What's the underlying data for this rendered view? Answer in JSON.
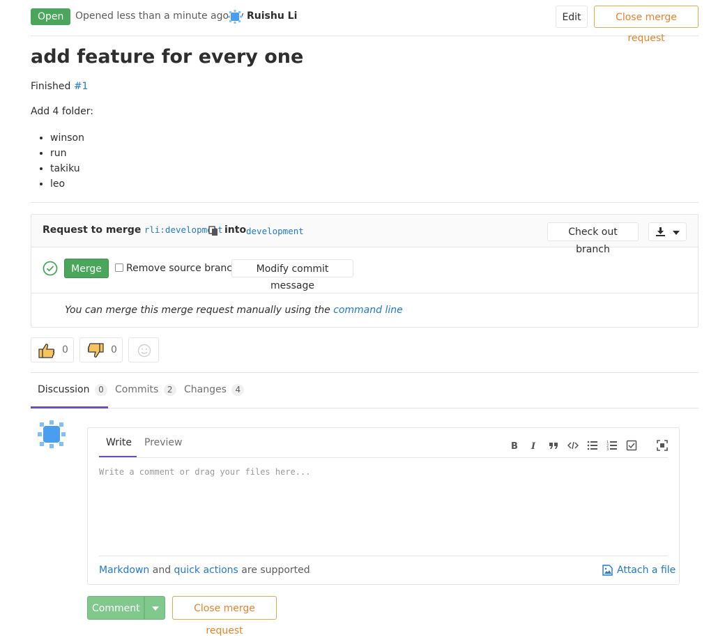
{
  "header": {
    "status_badge": "Open",
    "opened_text": "Opened less than a minute ago by",
    "author_name": "Ruishu Li",
    "edit_label": "Edit",
    "close_label": "Close merge request"
  },
  "title": "add feature for every one",
  "description": {
    "finished_prefix": "Finished",
    "finished_ref": "#1",
    "intro": "Add 4 folder:",
    "items": [
      "winson",
      "run",
      "takiku",
      "leo"
    ]
  },
  "merge_widget": {
    "request_label": "Request to merge",
    "source_branch": "rli:development",
    "into_label": "into",
    "target_branch": "development",
    "checkout_label": "Check out branch",
    "merge_label": "Merge",
    "remove_source_label": "Remove source branch",
    "modify_commit_label": "Modify commit message",
    "manual_text": "You can merge this merge request manually using the",
    "command_line_link": "command line"
  },
  "awards": {
    "thumbs_up_count": "0",
    "thumbs_down_count": "0"
  },
  "tabs": [
    {
      "label": "Discussion",
      "count": "0"
    },
    {
      "label": "Commits",
      "count": "2"
    },
    {
      "label": "Changes",
      "count": "4"
    }
  ],
  "comment_form": {
    "write_tab": "Write",
    "preview_tab": "Preview",
    "placeholder": "Write a comment or drag your files here...",
    "markdown_link": "Markdown",
    "and_text": "and",
    "quick_actions_link": "quick actions",
    "supported_text": "are supported",
    "attach_label": "Attach a file",
    "toolbar_icons": [
      "bold-icon",
      "italic-icon",
      "quote-icon",
      "code-icon",
      "bullet-list-icon",
      "numbered-list-icon",
      "task-list-icon",
      "fullscreen-icon"
    ]
  },
  "actions": {
    "comment_label": "Comment",
    "close_label": "Close merge request"
  },
  "colors": {
    "success": "#4aa65a",
    "link": "#1f78d1",
    "warning": "#e8822b",
    "active_tab": "#6b4fbb"
  }
}
